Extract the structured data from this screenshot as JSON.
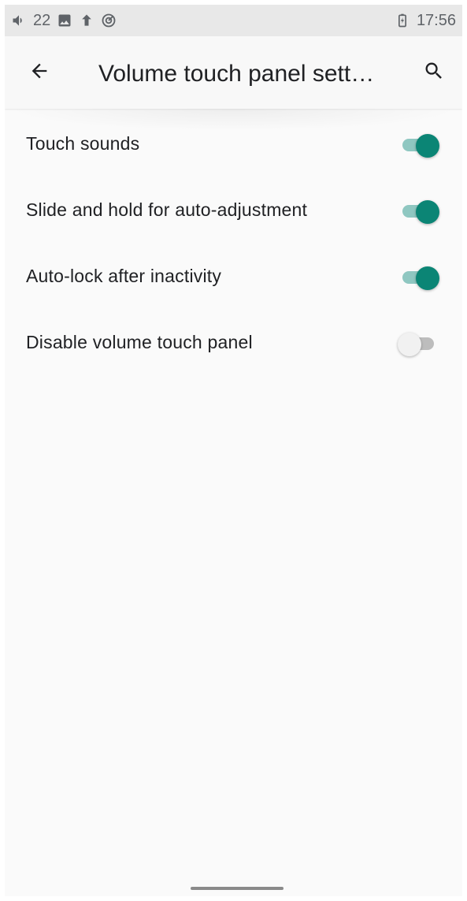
{
  "status_bar": {
    "left_text": "22",
    "icons_left": [
      "volume-icon",
      "image-icon",
      "upload-arrow-icon",
      "sync-icon"
    ],
    "battery_icon": "battery-charging-icon",
    "time": "17:56"
  },
  "app_bar": {
    "title": "Volume touch panel sett…",
    "back_icon": "arrow-left-icon",
    "search_icon": "search-icon"
  },
  "settings": [
    {
      "label": "Touch sounds",
      "enabled": true
    },
    {
      "label": "Slide and hold for auto-adjustment",
      "enabled": true
    },
    {
      "label": "Auto-lock after inactivity",
      "enabled": true
    },
    {
      "label": "Disable volume touch panel",
      "enabled": false
    }
  ],
  "colors": {
    "accent": "#0b8575",
    "accent_track": "#8fc7c1",
    "off_thumb": "#f1f1f1",
    "off_track": "#bdbdbd",
    "background": "#fafafa"
  }
}
